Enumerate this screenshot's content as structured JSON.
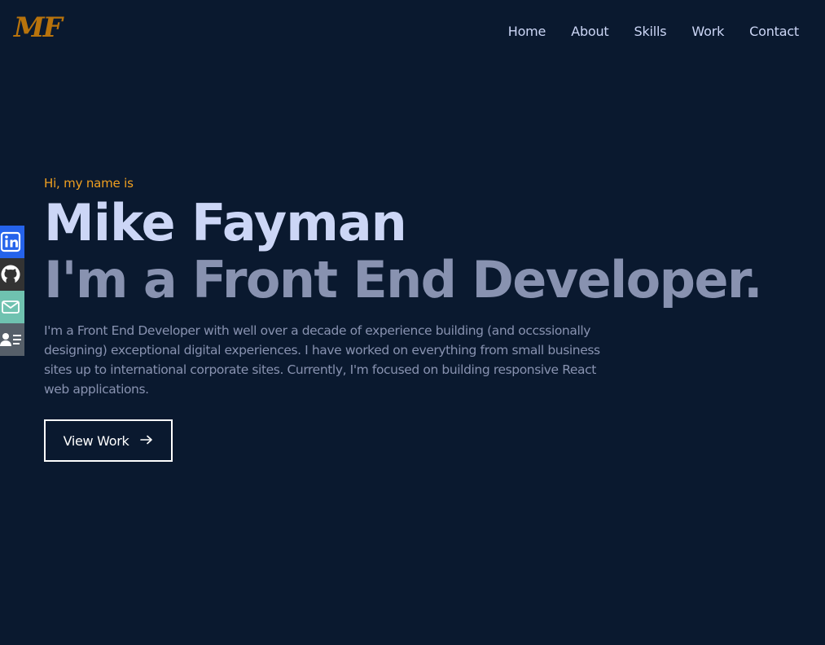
{
  "logo": {
    "text": "MF"
  },
  "nav": {
    "items": [
      {
        "label": "Home"
      },
      {
        "label": "About"
      },
      {
        "label": "Skills"
      },
      {
        "label": "Work"
      },
      {
        "label": "Contact"
      }
    ]
  },
  "social": {
    "items": [
      {
        "icon": "linkedin-icon",
        "color": "#2563eb"
      },
      {
        "icon": "github-icon",
        "color": "#333333"
      },
      {
        "icon": "email-icon",
        "color": "#6fc2b0"
      },
      {
        "icon": "resume-icon",
        "color": "#565f69"
      }
    ]
  },
  "hero": {
    "greeting": "Hi, my name is",
    "name": "Mike Fayman",
    "role": "I'm a Front End Developer.",
    "bio": "I'm a Front End Developer with well over a decade of experience building (and occssionally designing) exceptional digital experiences. I have worked on everything from small business sites up to international corporate sites. Currently, I'm focused on building responsive React web applications.",
    "button_label": "View Work",
    "button_icon": "arrow-right-icon"
  },
  "colors": {
    "background": "#0a192f",
    "accent": "#f0a020",
    "logo": "#b8730c",
    "heading": "#ccd6f6",
    "muted": "#8892b0"
  }
}
